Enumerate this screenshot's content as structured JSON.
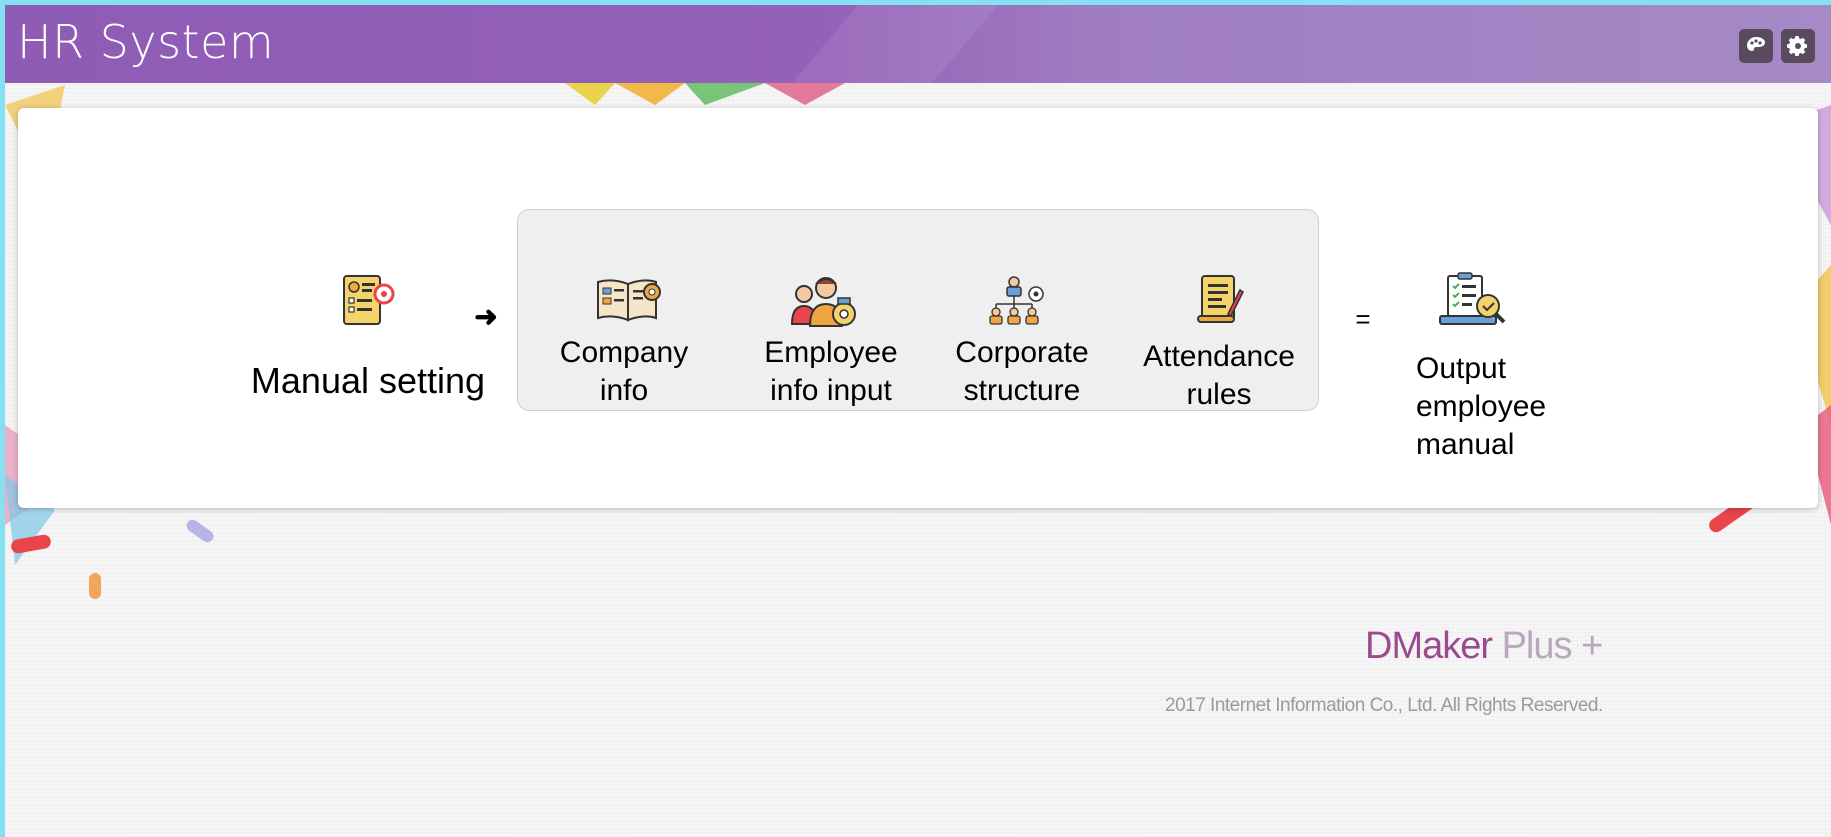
{
  "header": {
    "title": "HR System",
    "buttons": [
      {
        "name": "theme-button",
        "icon": "palette-icon"
      },
      {
        "name": "settings-button",
        "icon": "gear-icon"
      }
    ]
  },
  "flow": {
    "manual_setting": {
      "label": "Manual setting",
      "icon": "resume-target-icon"
    },
    "arrow": "➜",
    "steps": [
      {
        "line1": "Company",
        "line2": "info",
        "icon": "company-book-gear-icon"
      },
      {
        "line1": "Employee",
        "line2": "info input",
        "icon": "employees-badge-icon"
      },
      {
        "line1": "Corporate",
        "line2": "structure",
        "icon": "org-chart-icon"
      },
      {
        "line1": "Attendance",
        "line2": "rules",
        "icon": "checklist-scroll-icon"
      }
    ],
    "equals": "=",
    "output": {
      "line1": "Output",
      "line2": "employee",
      "line3": "manual",
      "icon": "laptop-checklist-icon"
    }
  },
  "footer": {
    "brand_main": "DMaker",
    "brand_plus": " Plus +",
    "copyright": "2017 Internet Information Co., Ltd. All Rights Reserved."
  },
  "colors": {
    "header": "#9461b8",
    "accent_orange": "#f0a640",
    "accent_blue": "#6aa0d8",
    "brand": "#9a4a8e"
  }
}
